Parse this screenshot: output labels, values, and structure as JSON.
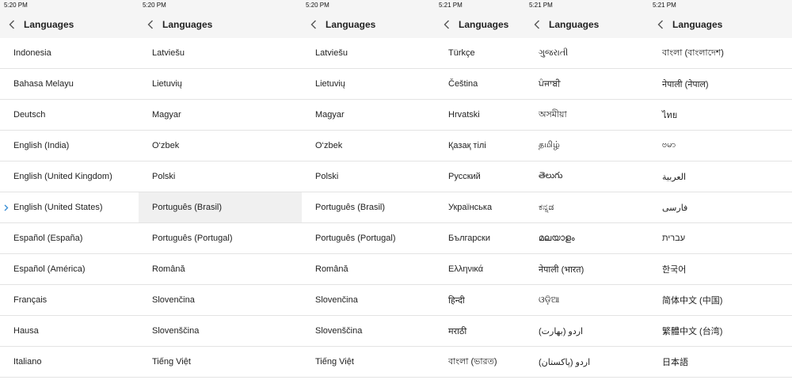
{
  "colors": {
    "accent": "#3a8fd6",
    "header_bg": "#f5f5f5",
    "divider": "#e3e3e3",
    "selected_bg": "#f0f0f0"
  },
  "panels": [
    {
      "time": "5:20 PM",
      "title": "Languages",
      "items": [
        "Indonesia",
        "Bahasa Melayu",
        "Deutsch",
        "English (India)",
        "English (United Kingdom)",
        "English (United States)",
        "Español (España)",
        "Español (América)",
        "Français",
        "Hausa",
        "Italiano"
      ],
      "current_index": 5
    },
    {
      "time": "5:20 PM",
      "title": "Languages",
      "items": [
        "Latviešu",
        "Lietuvių",
        "Magyar",
        "O‘zbek",
        "Polski",
        "Português (Brasil)",
        "Português (Portugal)",
        "Română",
        "Slovenčina",
        "Slovenščina",
        "Tiếng Việt"
      ],
      "highlight_index": 5
    },
    {
      "time": "5:20 PM",
      "title": "Languages",
      "items": [
        "Latviešu",
        "Lietuvių",
        "Magyar",
        "O‘zbek",
        "Polski",
        "Português (Brasil)",
        "Português (Portugal)",
        "Română",
        "Slovenčina",
        "Slovenščina",
        "Tiếng Việt"
      ]
    },
    {
      "time": "5:21 PM",
      "title": "Languages",
      "items": [
        "Türkçe",
        "Čeština",
        "Hrvatski",
        "Қазақ тілі",
        "Русский",
        "Українська",
        "Български",
        "Ελληνικά",
        "हिन्दी",
        "मराठी",
        "বাংলা (ভারত)"
      ]
    },
    {
      "time": "5:21 PM",
      "title": "Languages",
      "items": [
        "ગુજરાતી",
        "ਪੰਜਾਬੀ",
        "অসমীয়া",
        "தமிழ்",
        "తెలుగు",
        "ಕನ್ನಡ",
        "മലയാളം",
        "नेपाली (भारत)",
        "ଓଡ଼ିଆ",
        "اردو (بھارت)",
        "اردو (پاکستان)"
      ]
    },
    {
      "time": "5:21 PM",
      "title": "Languages",
      "items": [
        "বাংলা (বাংলাদেশ)",
        "नेपाली (नेपाल)",
        "ไทย",
        "ဗမာ",
        "العربية",
        "فارسی",
        "עברית",
        "한국어",
        "简体中文 (中国)",
        "繁體中文 (台湾)",
        "日本語"
      ]
    }
  ]
}
